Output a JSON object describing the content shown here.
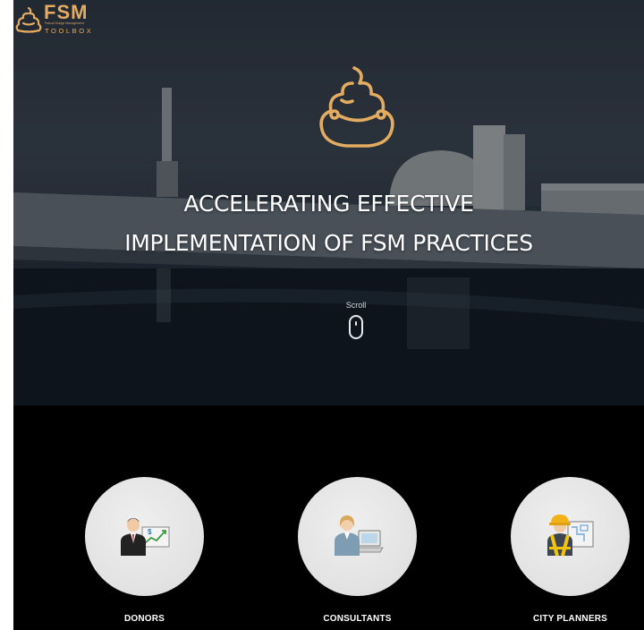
{
  "brand": {
    "name": "FSM",
    "tagline": "Faecal Sludge Management",
    "subtitle": "TOOLBOX",
    "logo_icon": "poop-logo-icon",
    "accent_color": "#e3ac60"
  },
  "hero": {
    "headline_line1": "ACCELERATING EFFECTIVE",
    "headline_line2": "IMPLEMENTATION OF FSM PRACTICES",
    "scroll_label": "Scroll",
    "scroll_icon": "mouse-scroll-icon",
    "background": "treatment-plant-photo"
  },
  "audience": [
    {
      "label": "DONORS",
      "icon": "donor-presenter-icon"
    },
    {
      "label": "CONSULTANTS",
      "icon": "consultant-laptop-icon"
    },
    {
      "label": "CITY PLANNERS",
      "icon": "city-planner-hardhat-icon"
    }
  ]
}
